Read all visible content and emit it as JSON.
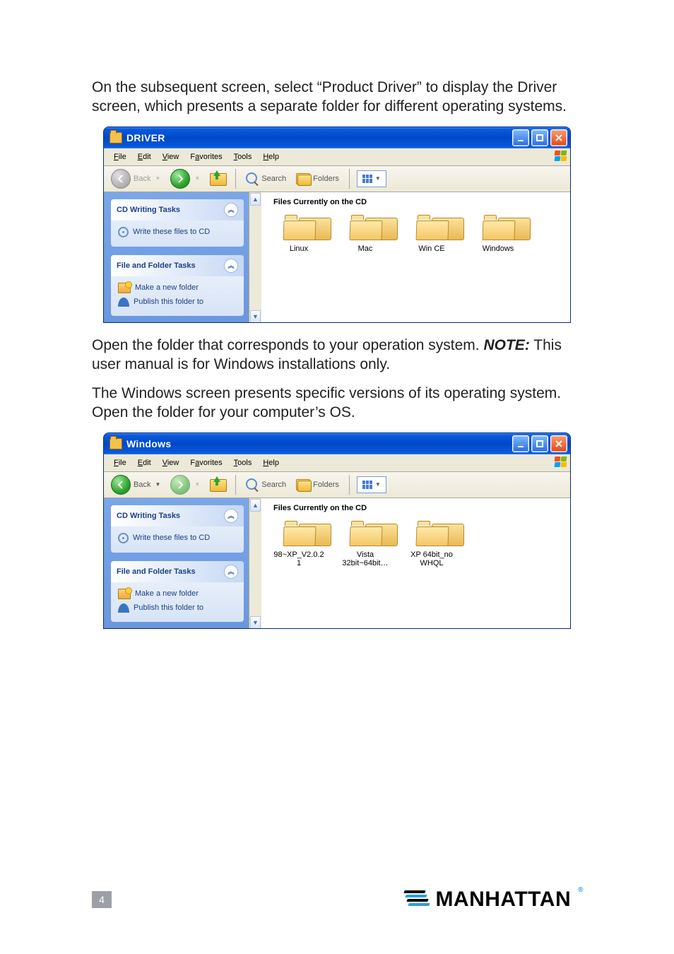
{
  "text": {
    "para1": "On the subsequent screen, select “Product Driver” to display the Driver screen, which presents a separate folder for different operating systems.",
    "para2a": "Open the folder that corresponds to your operation system. ",
    "para2_note": "NOTE:",
    "para2b": " This user manual is for Windows installations only.",
    "para3": "The Windows screen presents specific versions of its operating system. Open the folder for your computer’s OS."
  },
  "menus": {
    "file": "File",
    "edit": "Edit",
    "view": "View",
    "favorites": "Favorites",
    "tools": "Tools",
    "help": "Help"
  },
  "toolbar": {
    "back": "Back",
    "search": "Search",
    "folders": "Folders"
  },
  "sidebar": {
    "cd_title": "CD Writing Tasks",
    "cd_link": "Write these files to CD",
    "ff_title": "File and Folder Tasks",
    "newfolder": "Make a new folder",
    "publish_cut": "Publish this folder to"
  },
  "window1": {
    "title": "DRIVER",
    "files_header": "Files Currently on the CD",
    "folders": [
      "Linux",
      "Mac",
      "Win CE",
      "Windows"
    ]
  },
  "window2": {
    "title": "Windows",
    "files_header": "Files Currently on the CD",
    "folders": [
      "98~XP_V2.0.2 1",
      "Vista 32bit~64bit…",
      "XP 64bit_no WHQL"
    ]
  },
  "footer": {
    "page": "4",
    "brand": "MANHATTAN"
  }
}
